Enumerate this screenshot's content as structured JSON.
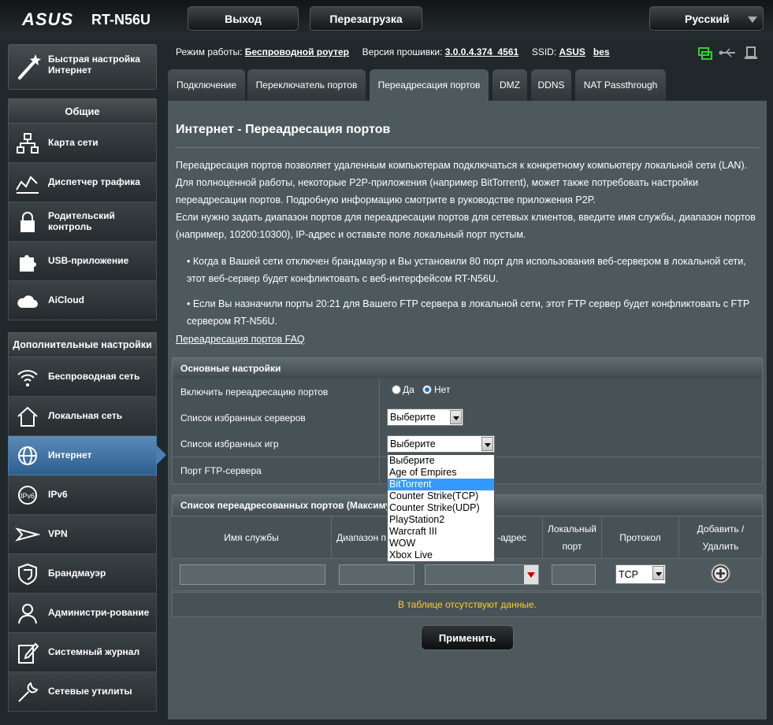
{
  "header": {
    "brand": "ASUS",
    "model": "RT-N56U",
    "logout": "Выход",
    "reboot": "Перезагрузка",
    "language": "Русский"
  },
  "info": {
    "mode_label": "Режим работы:",
    "mode_value": "Беспроводной роутер",
    "fw_label": "Версия прошивки:",
    "fw_value": "3.0.0.4.374_4561",
    "ssid_label": "SSID:",
    "ssid_1": "ASUS",
    "ssid_2": "bes"
  },
  "sidebar": {
    "quick_setup": "Быстрая настройка Интернет",
    "general_header": "Общие",
    "general": [
      {
        "label": "Карта сети",
        "icon": "network-map-icon"
      },
      {
        "label": "Диспетчер трафика",
        "icon": "traffic-icon"
      },
      {
        "label": "Родительский контроль",
        "icon": "lock-icon"
      },
      {
        "label": "USB-приложение",
        "icon": "puzzle-icon"
      },
      {
        "label": "AiCloud",
        "icon": "cloud-icon"
      }
    ],
    "advanced_header": "Дополнительные настройки",
    "advanced": [
      {
        "label": "Беспроводная сеть",
        "icon": "wifi-icon"
      },
      {
        "label": "Локальная сеть",
        "icon": "home-icon"
      },
      {
        "label": "Интернет",
        "icon": "globe-icon"
      },
      {
        "label": "IPv6",
        "icon": "ipv6-icon"
      },
      {
        "label": "VPN",
        "icon": "vpn-icon"
      },
      {
        "label": "Брандмауэр",
        "icon": "shield-icon"
      },
      {
        "label": "Администри-рование",
        "icon": "admin-icon"
      },
      {
        "label": "Системный журнал",
        "icon": "log-icon"
      },
      {
        "label": "Сетевые утилиты",
        "icon": "tools-icon"
      }
    ],
    "active": "Интернет"
  },
  "tabs": [
    "Подключение",
    "Переключатель портов",
    "Переадресация портов",
    "DMZ",
    "DDNS",
    "NAT Passthrough"
  ],
  "active_tab": "Переадресация портов",
  "page": {
    "title": "Интернет - Переадресация портов",
    "desc1": "Переадресация портов позволяет удаленным компьютерам подключаться к конкретному компьютеру локальной сети (LAN). Для полноценной работы, некоторые P2P-приложения (например BitTorrent), может также потребовать настройки переадресации портов. Подробную информацию смотрите в руководстве приложения P2P.",
    "desc2": "Если нужно задать диапазон портов для переадресации портов для сетевых клиентов, введите имя службы, диапазон портов (например, 10200:10300), IP-адрес и оставьте поле локальный порт пустым.",
    "bullet1": "Когда в Вашей сети отключен брандмауэр и Вы установили 80 порт для использования веб-сервером в локальной сети, этот веб-сервер будет конфликтовать с веб-интерфейсом RT-N56U.",
    "bullet2": "Если Вы назначили порты 20:21 для Вашего FTP сервера в локальной сети, этот FTP сервер будет конфликтовать с FTP сервером RT-N56U.",
    "faq": "Переадресация портов FAQ"
  },
  "basic": {
    "header": "Основные настройки",
    "enable_label": "Включить переадресацию портов",
    "yes": "Да",
    "no": "Нет",
    "enabled": "Нет",
    "servers_label": "Список избранных серверов",
    "servers_value": "Выберите",
    "games_label": "Список избранных игр",
    "games_value": "Выберите",
    "ftp_label": "Порт FTP-сервера",
    "games_options": [
      "Выберите",
      "Age of Empires",
      "BitTorrent",
      "Counter Strike(TCP)",
      "Counter Strike(UDP)",
      "PlayStation2",
      "Warcraft III",
      "WOW",
      "Xbox Live"
    ],
    "highlighted_option": "BitTorrent"
  },
  "list": {
    "header": "Список переадресованных портов (Максиму",
    "col_service": "Имя службы",
    "col_range": "Диапазон п",
    "col_ip": "-адрес",
    "col_local": "Локальный порт",
    "col_proto": "Протокол",
    "col_add": "Добавить / Удалить",
    "proto_value": "TCP",
    "empty": "В таблице отсутствуют данные."
  },
  "apply": "Применить",
  "colors": {
    "accent": "#4a7fb0",
    "empty_text": "#ffcc33",
    "content_bg": "#4d595d"
  }
}
